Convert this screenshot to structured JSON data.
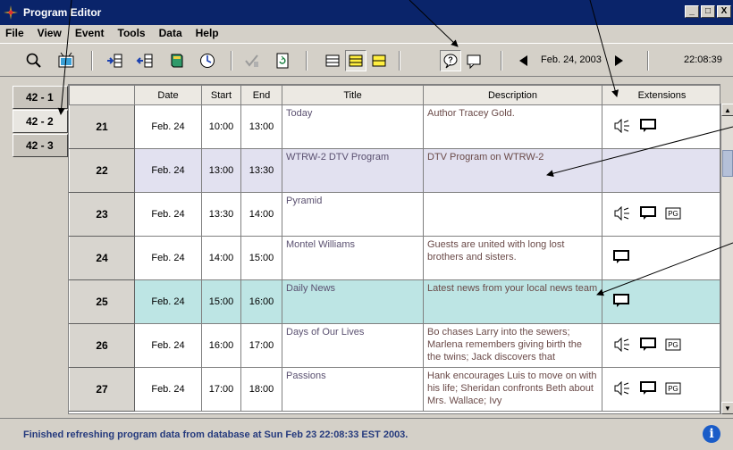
{
  "window": {
    "title": "Program Editor",
    "controls": [
      "_",
      "□",
      "X"
    ]
  },
  "menu": [
    "File",
    "View",
    "Event",
    "Tools",
    "Data",
    "Help"
  ],
  "toolbar": {
    "date": "Feb. 24, 2003",
    "time": "22:08:39"
  },
  "tabs": [
    "42 - 1",
    "42 - 2",
    "42 - 3"
  ],
  "columns": [
    "",
    "Date",
    "Start",
    "End",
    "Title",
    "Description",
    "Extensions"
  ],
  "rows": [
    {
      "num": "21",
      "date": "Feb. 24",
      "start": "10:00",
      "end": "13:00",
      "title": "Today",
      "desc": "Author Tracey Gold.",
      "ext": [
        "sound",
        "caption"
      ]
    },
    {
      "num": "22",
      "date": "Feb. 24",
      "start": "13:00",
      "end": "13:30",
      "title": "WTRW-2 DTV Program",
      "desc": "DTV Program on WTRW-2",
      "ext": []
    },
    {
      "num": "23",
      "date": "Feb. 24",
      "start": "13:30",
      "end": "14:00",
      "title": "Pyramid",
      "desc": "",
      "ext": [
        "sound",
        "caption",
        "rating"
      ]
    },
    {
      "num": "24",
      "date": "Feb. 24",
      "start": "14:00",
      "end": "15:00",
      "title": "Montel Williams",
      "desc": "Guests are united with long lost brothers and sisters.",
      "ext": [
        "caption"
      ]
    },
    {
      "num": "25",
      "date": "Feb. 24",
      "start": "15:00",
      "end": "16:00",
      "title": "Daily News",
      "desc": "Latest news from your local news team",
      "ext": [
        "caption"
      ]
    },
    {
      "num": "26",
      "date": "Feb. 24",
      "start": "16:00",
      "end": "17:00",
      "title": "Days of Our Lives",
      "desc": "Bo chases Larry into the sewers; Marlena remembers giving birth the the twins; Jack discovers that",
      "ext": [
        "sound",
        "caption",
        "rating"
      ]
    },
    {
      "num": "27",
      "date": "Feb. 24",
      "start": "17:00",
      "end": "18:00",
      "title": "Passions",
      "desc": "Hank encourages Luis to move on with his life; Sheridan confronts Beth about Mrs. Wallace; Ivy",
      "ext": [
        "sound",
        "caption",
        "rating"
      ]
    }
  ],
  "ext_icons": {
    "sound": "speaker-icon",
    "caption": "caption-icon",
    "rating": "pg-rating-icon",
    "rating_text": "PG"
  },
  "status": "Finished refreshing program data from database at Sun Feb 23 22:08:33 EST 2003.",
  "status_icon": "i"
}
